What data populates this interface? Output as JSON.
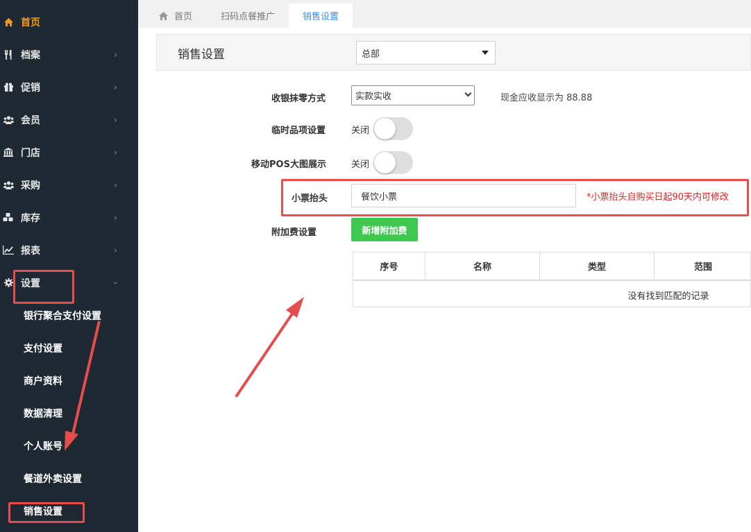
{
  "sidebar": {
    "items": [
      {
        "label": "首页",
        "icon": "home-icon",
        "active": true
      },
      {
        "label": "档案",
        "icon": "utensils-icon"
      },
      {
        "label": "促销",
        "icon": "gift-icon"
      },
      {
        "label": "会员",
        "icon": "users-icon"
      },
      {
        "label": "门店",
        "icon": "bank-icon"
      },
      {
        "label": "采购",
        "icon": "users-icon"
      },
      {
        "label": "库存",
        "icon": "cubes-icon"
      },
      {
        "label": "报表",
        "icon": "line-chart-icon"
      },
      {
        "label": "设置",
        "icon": "gear-icon",
        "expanded": true
      }
    ],
    "sub_items": [
      {
        "label": "银行聚合支付设置"
      },
      {
        "label": "支付设置"
      },
      {
        "label": "商户资料"
      },
      {
        "label": "数据清理"
      },
      {
        "label": "个人账号"
      },
      {
        "label": "餐道外卖设置"
      },
      {
        "label": "销售设置"
      }
    ]
  },
  "tabs": [
    {
      "label": "首页",
      "icon": "home-icon"
    },
    {
      "label": "扫码点餐推广"
    },
    {
      "label": "销售设置",
      "active": true
    }
  ],
  "header": {
    "title": "销售设置",
    "store_select": "总部"
  },
  "form": {
    "rounding": {
      "label": "收银抹零方式",
      "value": "实款实收",
      "hint": "现金应收显示为 88.88"
    },
    "temp_item": {
      "label": "临时品项设置",
      "state_label": "关闭"
    },
    "pos_big_image": {
      "label": "移动POS大图展示",
      "state_label": "关闭"
    },
    "receipt_header": {
      "label": "小票抬头",
      "value": "餐饮小票",
      "note": "*小票抬头自购买日起90天内可修改"
    },
    "surcharge": {
      "label": "附加费设置",
      "button": "新增附加费"
    }
  },
  "table": {
    "columns": [
      "序号",
      "名称",
      "类型",
      "范围"
    ],
    "empty_text": "没有找到匹配的记录"
  },
  "colors": {
    "sidebar_bg": "#1f2933",
    "active_orange": "#f39c12",
    "tab_active_blue": "#3a8ee6",
    "green_button": "#3fc84f",
    "annotation_red": "#e84c4c"
  }
}
